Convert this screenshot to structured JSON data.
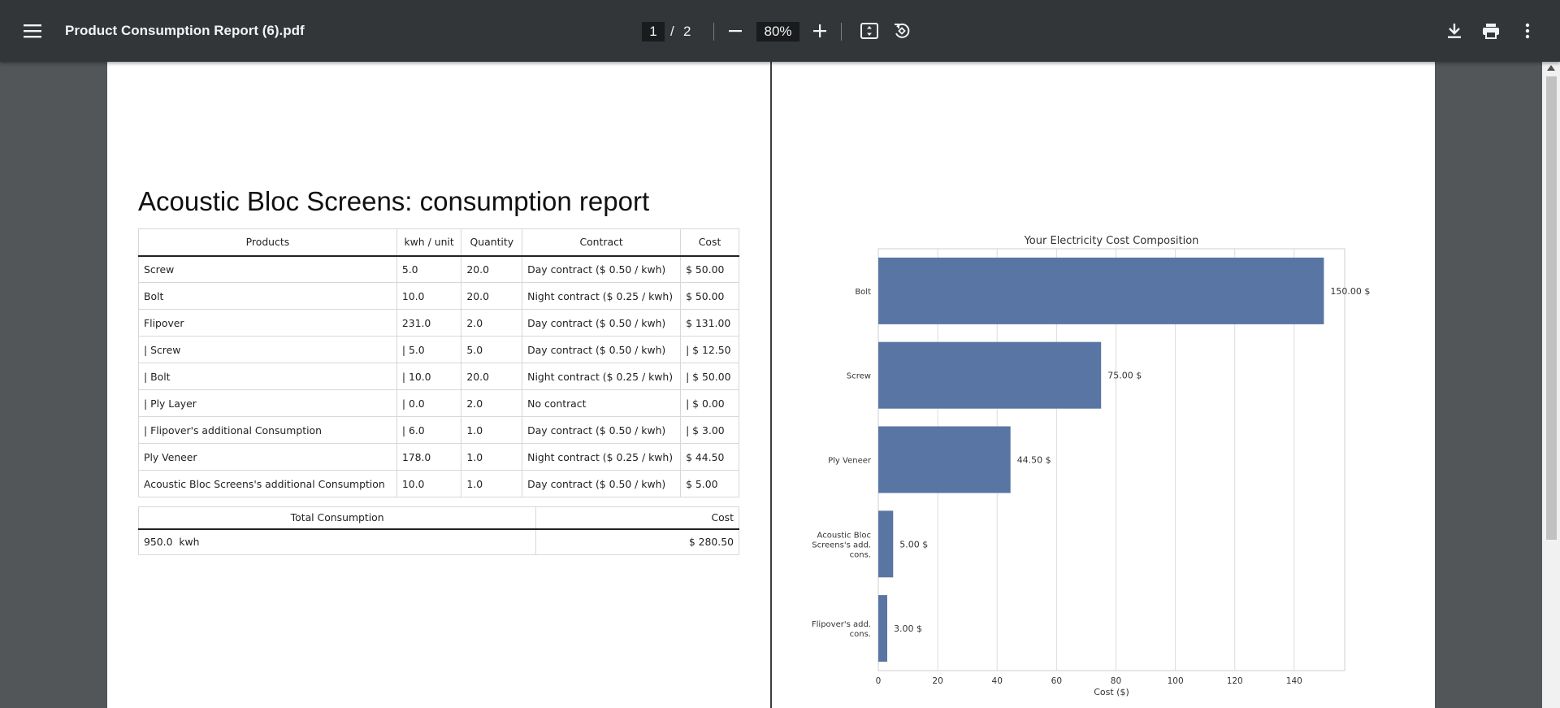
{
  "toolbar": {
    "title": "Product Consumption Report (6).pdf",
    "current_page": "1",
    "page_separator": "/",
    "total_pages": "2",
    "zoom": "80%",
    "icons": [
      "menu-icon",
      "zoom-out-icon",
      "zoom-in-icon",
      "fit-page-icon",
      "rotate-icon",
      "download-icon",
      "print-icon",
      "more-icon"
    ]
  },
  "report": {
    "title": "Acoustic Bloc Screens: consumption report",
    "columns": [
      "Products",
      "kwh / unit",
      "Quantity",
      "Contract",
      "Cost"
    ],
    "rows": [
      [
        "Screw",
        "5.0",
        "20.0",
        "Day contract ($ 0.50 / kwh)",
        "$ 50.00"
      ],
      [
        "Bolt",
        "10.0",
        "20.0",
        "Night contract ($ 0.25 / kwh)",
        "$ 50.00"
      ],
      [
        "Flipover",
        "231.0",
        "2.0",
        "Day contract ($ 0.50 / kwh)",
        "$ 131.00"
      ],
      [
        "| Screw",
        "| 5.0",
        "5.0",
        "Day contract ($ 0.50 / kwh)",
        "| $ 12.50"
      ],
      [
        "| Bolt",
        "| 10.0",
        "20.0",
        "Night contract ($ 0.25 / kwh)",
        "| $ 50.00"
      ],
      [
        "| Ply Layer",
        "| 0.0",
        "2.0",
        "No contract",
        "| $ 0.00"
      ],
      [
        "| Flipover's additional Consumption",
        "| 6.0",
        "1.0",
        "Day contract ($ 0.50 / kwh)",
        "| $ 3.00"
      ],
      [
        "Ply Veneer",
        "178.0",
        "1.0",
        "Night contract ($ 0.25 / kwh)",
        "$ 44.50"
      ],
      [
        "Acoustic Bloc Screens's additional Consumption",
        "10.0",
        "1.0",
        "Day contract ($ 0.50 / kwh)",
        "$ 5.00"
      ]
    ],
    "total_header": "Total Consumption",
    "total_cost_header": "Cost",
    "total_consumption": "950.0  kwh",
    "total_cost": "$ 280.50"
  },
  "chart_data": {
    "type": "bar",
    "orientation": "horizontal",
    "title": "Your Electricity Cost Composition",
    "xlabel": "Cost ($)",
    "ylabel": "",
    "xlim": [
      0,
      157
    ],
    "xticks": [
      0,
      20,
      40,
      60,
      80,
      100,
      120,
      140
    ],
    "grid": "vertical",
    "bar_color": "#5875a4",
    "categories": [
      [
        "Bolt"
      ],
      [
        "Screw"
      ],
      [
        "Ply Veneer"
      ],
      [
        "Acoustic Bloc",
        "Screens's add.",
        "cons."
      ],
      [
        "Flipover's add.",
        "cons."
      ]
    ],
    "values": [
      150.0,
      75.0,
      44.5,
      5.0,
      3.0
    ],
    "value_labels": [
      "150.00 $",
      "75.00 $",
      "44.50 $",
      "5.00 $",
      "3.00 $"
    ]
  }
}
